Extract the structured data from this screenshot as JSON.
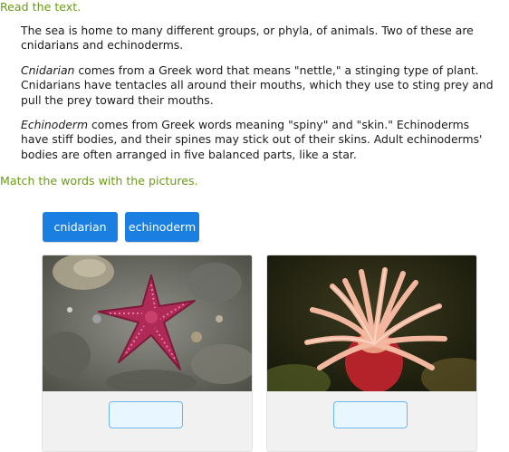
{
  "header": {
    "instruction": "Read the text."
  },
  "passage": {
    "p1": "The sea is home to many different groups, or phyla, of animals. Two of these are cnidarians and echinoderms.",
    "p2_term": "Cnidarian",
    "p2_rest": " comes from a Greek word that means \"nettle,\" a stinging type of plant. Cnidarians have tentacles all around their mouths, which they use to sting prey and pull the prey toward their mouths.",
    "p3_term": "Echinoderm",
    "p3_rest": " comes from Greek words meaning \"spiny\" and \"skin.\" Echinoderms have stiff bodies, and their spines may stick out of their skins. Adult echinoderms' bodies are often arranged in five balanced parts, like a star."
  },
  "task": {
    "instruction": "Match the words with the pictures."
  },
  "tiles": [
    {
      "label": "cnidarian"
    },
    {
      "label": "echinoderm"
    }
  ],
  "pictures": [
    {
      "subject": "red sea star on rocky reef",
      "answer": ""
    },
    {
      "subject": "sea anemone with pale tentacles",
      "answer": ""
    }
  ],
  "colors": {
    "instruction_green": "#6a9c14",
    "tile_blue": "#1a7fe0",
    "dropzone_border": "#6fb7e8",
    "dropzone_fill": "#e8f6ff"
  }
}
